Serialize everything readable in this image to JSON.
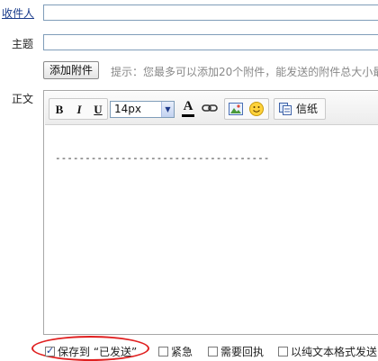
{
  "form": {
    "recipient_label": "收件人",
    "recipient_value": "",
    "subject_label": "主题",
    "subject_value": "",
    "attach_button": "添加附件",
    "attach_hint": "提示：您最多可以添加20个附件，能发送的附件总大小最",
    "body_label": "正文"
  },
  "toolbar": {
    "bold": "B",
    "italic": "I",
    "underline": "U",
    "font_size": "14px",
    "font_color_glyph": "A",
    "link_glyph": "⊝",
    "stationery_label": "信纸"
  },
  "editor": {
    "content": "------------------------------------"
  },
  "options": [
    {
      "label": "保存到 “已发送”",
      "checked": true
    },
    {
      "label": "紧急",
      "checked": false
    },
    {
      "label": "需要回执",
      "checked": false
    },
    {
      "label": "以纯文本格式发送",
      "checked": false
    }
  ],
  "colors": {
    "highlight_ellipse": "#e02020",
    "link_label": "#1a3c8c"
  }
}
